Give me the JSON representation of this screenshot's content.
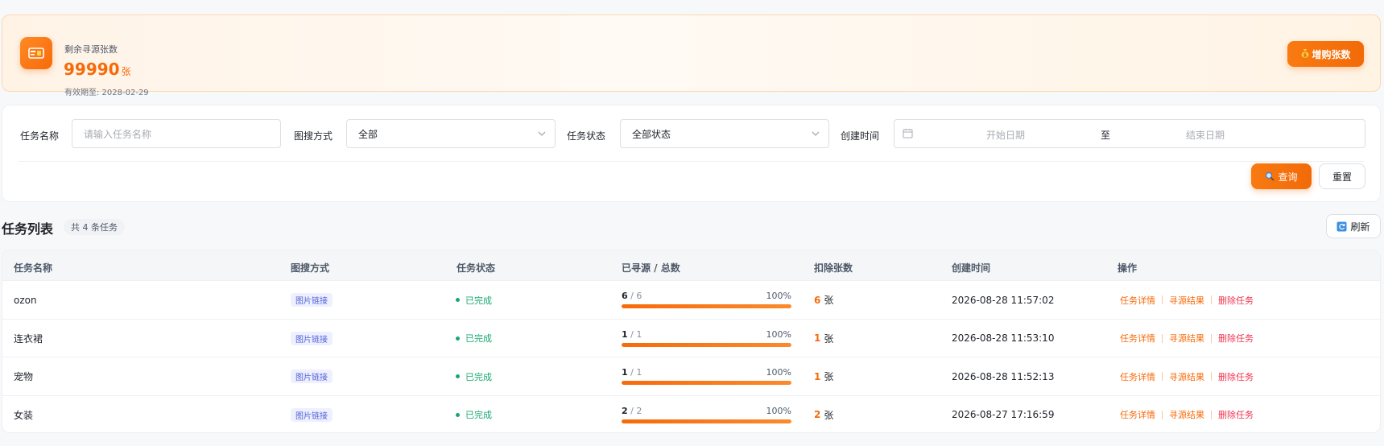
{
  "quota": {
    "label": "剩余寻源张数",
    "value": "99990",
    "unit": "张",
    "expire": "有效期至: 2028-02-29",
    "buy_label": "增购张数"
  },
  "filters": {
    "task_name_label": "任务名称",
    "task_name_placeholder": "请输入任务名称",
    "search_mode_label": "图搜方式",
    "search_mode_value": "全部",
    "status_label": "任务状态",
    "status_value": "全部状态",
    "created_label": "创建时间",
    "start_placeholder": "开始日期",
    "range_sep": "至",
    "end_placeholder": "结束日期",
    "query_label": "查询",
    "reset_label": "重置"
  },
  "list": {
    "title": "任务列表",
    "count": "共 4 条任务",
    "refresh_label": "刷新"
  },
  "table": {
    "columns": [
      "任务名称",
      "图搜方式",
      "任务状态",
      "已寻源 / 总数",
      "扣除张数",
      "创建时间",
      "操作"
    ],
    "rows": [
      {
        "name": "ozon",
        "mode": "图片链接",
        "status": "已完成",
        "done": "6",
        "total": "/ 6",
        "pct": "100%",
        "progress": 1.0,
        "deduct": "6",
        "deduct_unit": "张",
        "created": "2026-08-28 11:57:02",
        "op_detail": "任务详情",
        "op_result": "寻源结果",
        "op_delete": "删除任务"
      },
      {
        "name": "连衣裙",
        "mode": "图片链接",
        "status": "已完成",
        "done": "1",
        "total": "/ 1",
        "pct": "100%",
        "progress": 1.0,
        "deduct": "1",
        "deduct_unit": "张",
        "created": "2026-08-28 11:53:10",
        "op_detail": "任务详情",
        "op_result": "寻源结果",
        "op_delete": "删除任务"
      },
      {
        "name": "宠物",
        "mode": "图片链接",
        "status": "已完成",
        "done": "1",
        "total": "/ 1",
        "pct": "100%",
        "progress": 1.0,
        "deduct": "1",
        "deduct_unit": "张",
        "created": "2026-08-28 11:52:13",
        "op_detail": "任务详情",
        "op_result": "寻源结果",
        "op_delete": "删除任务"
      },
      {
        "name": "女装",
        "mode": "图片链接",
        "status": "已完成",
        "done": "2",
        "total": "/ 2",
        "pct": "100%",
        "progress": 1.0,
        "deduct": "2",
        "deduct_unit": "张",
        "created": "2026-08-27 17:16:59",
        "op_detail": "任务详情",
        "op_result": "寻源结果",
        "op_delete": "删除任务"
      }
    ]
  },
  "colors": {
    "accent": "#f76a0a",
    "success": "#17a870",
    "danger": "#f0344e",
    "tag_text": "#4f5fd6"
  },
  "icons": {
    "quota": "ticket-icon",
    "buy": "moneybag-icon",
    "query": "search-icon",
    "refresh": "refresh-icon",
    "calendar": "calendar-icon",
    "dropdown": "chevron-down-icon"
  }
}
